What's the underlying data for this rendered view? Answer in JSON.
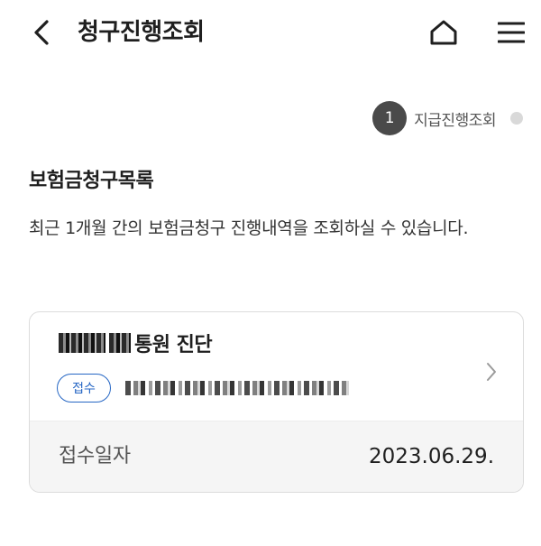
{
  "header": {
    "title": "청구진행조회"
  },
  "step": {
    "number": "1",
    "label": "지급진행조회"
  },
  "section": {
    "title": "보험금청구목록",
    "description": "최근 1개월 간의 보험금청구 진행내역을 조회하실 수 있습니다."
  },
  "claim_card": {
    "title_suffix": "통원 진단",
    "status_badge": "접수",
    "date_label": "접수일자",
    "date_value": "2023.06.29."
  },
  "icons": {
    "back": "chevron-left-icon",
    "home": "home-icon",
    "menu": "hamburger-menu-icon",
    "card_arrow": "chevron-right-icon"
  },
  "colors": {
    "accent": "#2566c4",
    "step_active": "#4a4a4a",
    "step_inactive": "#d9d9d9",
    "card_footer_bg": "#f5f5f5"
  }
}
